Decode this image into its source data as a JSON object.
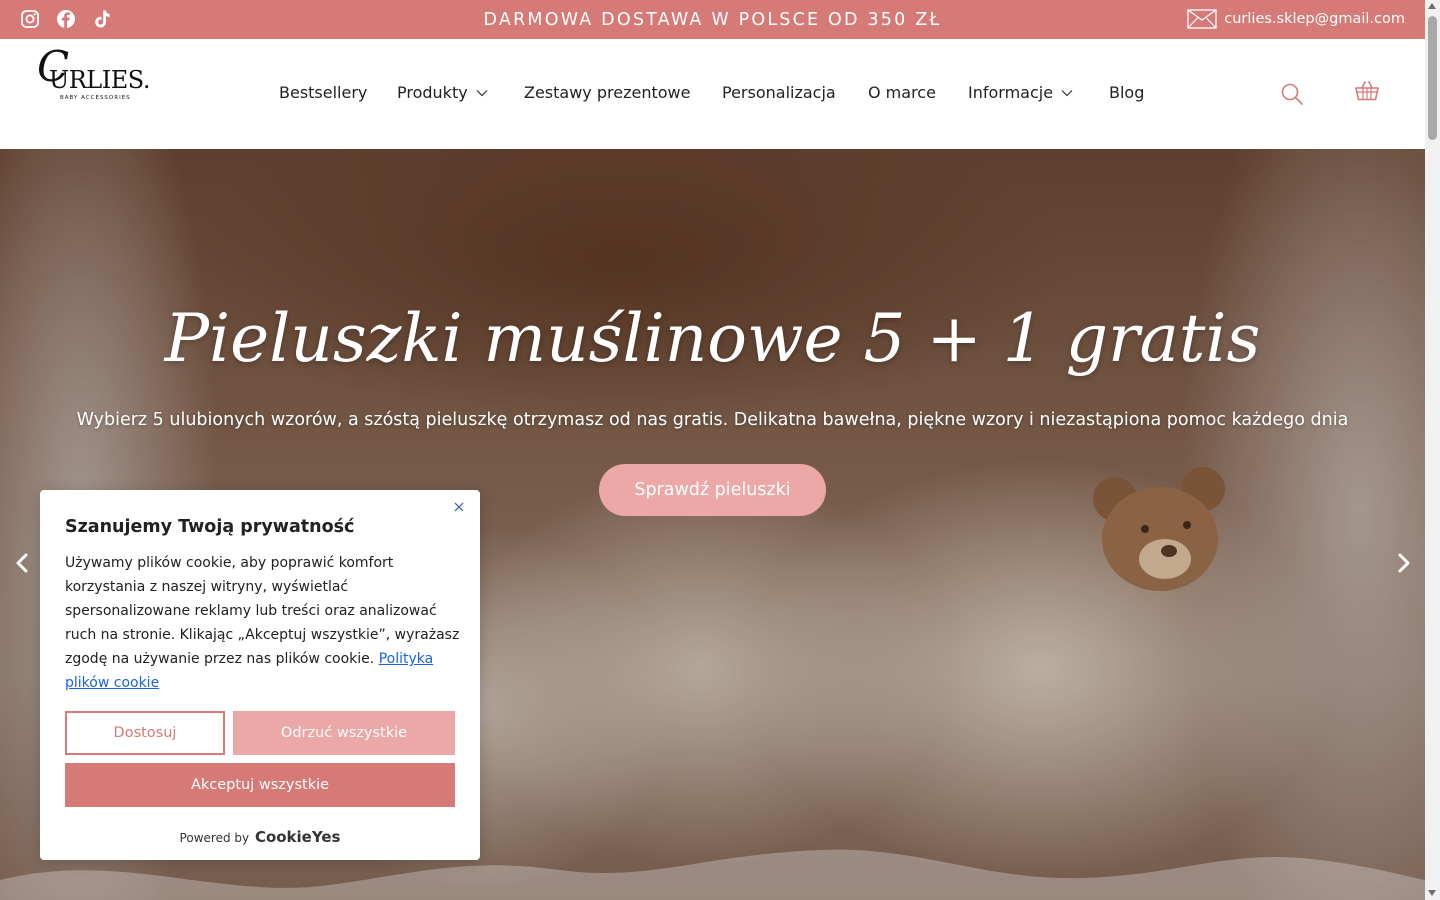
{
  "colors": {
    "accent": "#d57a77",
    "accent_light": "#eba8a6",
    "link": "#1863dc"
  },
  "topbar": {
    "social_icons": [
      "instagram-icon",
      "facebook-icon",
      "tiktok-icon"
    ],
    "promo": "DARMOWA DOSTAWA W POLSCE OD 350 ZŁ",
    "email": "curlies.sklep@gmail.com"
  },
  "header": {
    "logo": {
      "script": "C",
      "word": "URLIES.",
      "sub": "BABY ACCESSORIES"
    },
    "nav": [
      {
        "label": "Bestsellery"
      },
      {
        "label": "Produkty"
      },
      {
        "label": "Zestawy prezentowe"
      },
      {
        "label": "Personalizacja"
      },
      {
        "label": "O marce"
      },
      {
        "label": "Informacje"
      },
      {
        "label": "Blog"
      }
    ],
    "icons": [
      "search-icon",
      "basket-icon"
    ]
  },
  "hero": {
    "title": "Pieluszki muślinowe 5 + 1 gratis",
    "subtitle": "Wybierz 5 ulubionych wzorów, a szóstą pieluszkę otrzymasz od nas gratis. Delikatna bawełna, piękne wzory i niezastąpiona pomoc każdego dnia",
    "button": "Sprawdź pieluszki"
  },
  "cookie": {
    "title": "Szanujemy Twoją prywatność",
    "text": "Używamy plików cookie, aby poprawić komfort korzystania z naszej witryny, wyświetlać spersonalizowane reklamy lub treści oraz analizować ruch na stronie. Klikając „Akceptuj wszystkie”, wyrażasz zgodę na używanie przez nas plików cookie.",
    "link": "Polityka plików cookie",
    "btn_customize": "Dostosuj",
    "btn_reject": "Odrzuć wszystkie",
    "btn_accept": "Akceptuj wszystkie",
    "powered_by": "Powered by",
    "powered_brand": "CookieYes"
  }
}
